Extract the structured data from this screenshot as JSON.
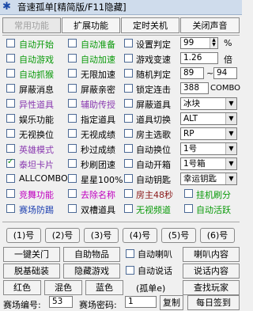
{
  "window": {
    "icon": "app-logo-icon",
    "title": "音速孤单[精简版/F11隐藏]"
  },
  "tabs": [
    {
      "label": "常用功能",
      "disabled": true
    },
    {
      "label": "扩展功能"
    },
    {
      "label": "定时关机"
    },
    {
      "label": "关闭声音"
    }
  ],
  "grid": {
    "r1": {
      "c1": "自动开始",
      "c2": "自动准备",
      "c3": "设置判定",
      "v": "99",
      "unit": "%"
    },
    "r2": {
      "c1": "自动游戏",
      "c2": "自动加速",
      "c3": "游戏变速",
      "v": "1.26",
      "unit": "倍"
    },
    "r3": {
      "c1": "自动抓猴",
      "c2": "无限加速",
      "c3": "随机判定",
      "v1": "89",
      "sep": "~",
      "v2": "94"
    },
    "r4": {
      "c1": "屏蔽消息",
      "c2": "屏蔽亲密",
      "c3": "锁定连击",
      "v": "388",
      "unit": "COMBO"
    },
    "r5": {
      "c1": "异性道具",
      "c2": "辅助传授",
      "c3": "屏蔽道具",
      "v": "冰块"
    },
    "r6": {
      "c1": "娱乐功能",
      "c2": "指定道具",
      "c3": "道具切换",
      "v": "ALT"
    },
    "r7": {
      "c1": "无视换位",
      "c2": "无视成绩",
      "c3": "房主选歌",
      "v": "RP"
    },
    "r8": {
      "c1": "英雄模式",
      "c2": "秒过成绩",
      "c3": "自动换位",
      "v": "1号"
    },
    "r9": {
      "c1": "泰坦卡片",
      "c2": "秒刷团速",
      "c3": "自动开箱",
      "v": "1号箱"
    },
    "r10": {
      "c1": "ALLCOMBO",
      "c2": "星星100%",
      "c3": "自动钥匙",
      "v": "幸运钥匙"
    },
    "r11": {
      "c1": "竞舞功能",
      "c2": "去除名称",
      "c3": "房主48秒",
      "c4": "挂机刷分"
    },
    "r12": {
      "c1": "赛场防踢",
      "c2": "双槽道具",
      "c3": "无视频道",
      "c4": "自动活跃"
    }
  },
  "seats": [
    "(1)号",
    "(2)号",
    "(3)号",
    "(4)号",
    "(5)号",
    "(6)号"
  ],
  "actions": {
    "a1": "一键关门",
    "a2": "自助物品",
    "a3": "自动喇叭",
    "a4": "喇叭内容",
    "b1": "脱基础装",
    "b2": "隐藏游戏",
    "b3": "自动说话",
    "b4": "说话内容",
    "c1": "红色",
    "c2": "混色",
    "c3": "蓝色",
    "c4": "(孤单e)",
    "c5": "查找玩家"
  },
  "bottom": {
    "room_no_label": "赛场编号:",
    "room_no": "53",
    "room_pwd_label": "赛场密码:",
    "room_pwd": "1",
    "copy": "复制",
    "daily": "每日签到"
  }
}
